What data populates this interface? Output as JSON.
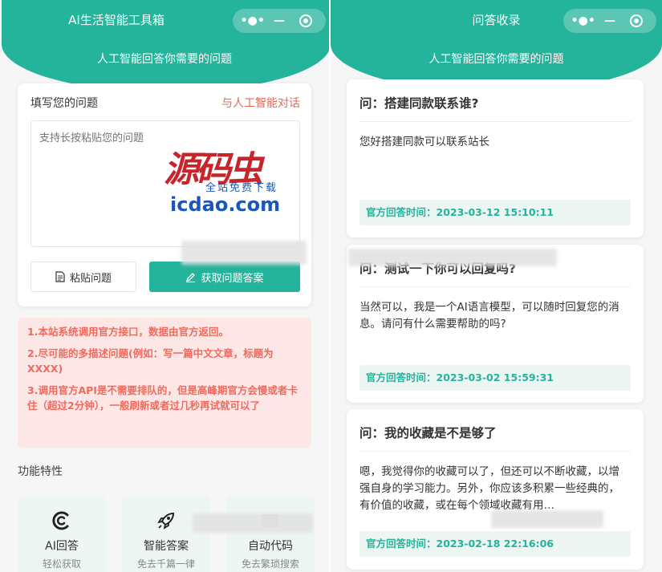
{
  "left": {
    "nav_title": "AI生活智能工具箱",
    "subtitle": "人工智能回答你需要的问题",
    "question": {
      "label": "填写您的问题",
      "ai_link": "与人工智能对话",
      "placeholder": "支持长按粘贴您的问题",
      "paste_button": "粘贴问题",
      "answer_button": "获取问题答案"
    },
    "notice": [
      "1.本站系统调用官方接口，数据由官方返回。",
      "2.尽可能的多描述问题(例如：写一篇中文文章，标题为XXXX)",
      "3.调用官方API是不需要排队的，但是高峰期官方会慢或者卡住（超过2分钟），一般刷新或者过几秒再试就可以了"
    ],
    "features_title": "功能特性",
    "features": [
      {
        "name": "AI回答",
        "sub": "轻松获取",
        "icon": "c-logo-icon"
      },
      {
        "name": "智能答案",
        "sub": "免去千篇一律",
        "icon": "rocket-icon"
      },
      {
        "name": "自动代码",
        "sub": "免去繁琐搜索",
        "icon": "code-icon"
      }
    ],
    "watermark": {
      "cn": "源码虫",
      "sub": "全站免费下载",
      "url": "icdao.com"
    }
  },
  "right": {
    "nav_title": "问答收录",
    "subtitle": "人工智能回答你需要的问题",
    "qa": [
      {
        "q": "问：搭建同款联系谁?",
        "a": "您好搭建同款可以联系站长",
        "time": "官方回答时间：2023-03-12 15:10:11"
      },
      {
        "q": "问：测试一下你可以回复吗?",
        "a": "当然可以，我是一个AI语言模型，可以随时回复您的消息。请问有什么需要帮助的吗?",
        "time": "官方回答时间：2023-03-02 15:59:31"
      },
      {
        "q": "问：我的收藏是不是够了",
        "a": "嗯，我觉得你的收藏可以了，但还可以不断收藏，以增强自身的学习能力。另外，你应该多积累一些经典的，有价值的收藏，或在每个领域收藏有用…",
        "time": "官方回答时间：2023-02-18 22:16:06"
      }
    ]
  },
  "capsule": {
    "more": "•●•",
    "minimize": "—"
  },
  "colors": {
    "primary": "#24b39b",
    "warning_text": "#f06b5e",
    "warning_bg": "#fde6e6",
    "link": "#e06b5a"
  }
}
